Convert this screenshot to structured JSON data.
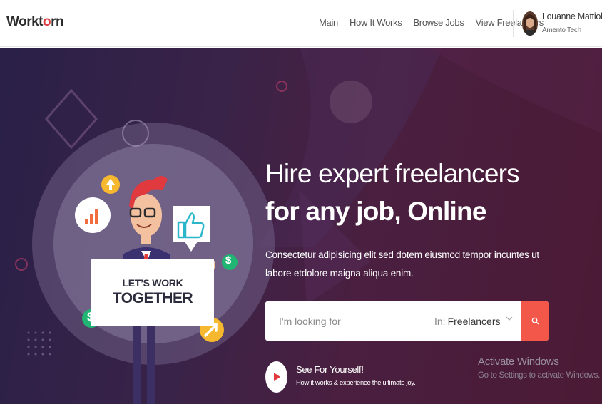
{
  "header": {
    "logo_text_a": "Workt",
    "logo_text_b": "o",
    "logo_text_c": "rn",
    "nav": [
      {
        "label": "Main"
      },
      {
        "label": "How It Works"
      },
      {
        "label": "Browse Jobs"
      },
      {
        "label": "View Freelancers"
      }
    ],
    "user": {
      "name": "Louanne Mattioli",
      "company": "Amento Tech"
    }
  },
  "hero": {
    "title_line1": "Hire expert freelancers",
    "title_line2": "for any job, Online",
    "description": "Consectetur adipisicing elit sed dotem eiusmod tempor incuntes ut labore etdolore maigna aliqua enim.",
    "illustration": {
      "sign_line1": "LET’S WORK",
      "sign_line2": "TOGETHER"
    },
    "search": {
      "placeholder": "I'm looking for",
      "category_prefix": "In:",
      "category_value": "Freelancers",
      "button_icon": "search-icon"
    },
    "video": {
      "title": "See For Yourself!",
      "subtitle": "How it works & experience the ultimate joy."
    }
  },
  "watermark": {
    "title": "Activate Windows",
    "subtitle": "Go to Settings to activate Windows."
  },
  "colors": {
    "accent": "#f2574a",
    "hero_bg": "#3a2348",
    "logo_accent": "#e0393e"
  }
}
